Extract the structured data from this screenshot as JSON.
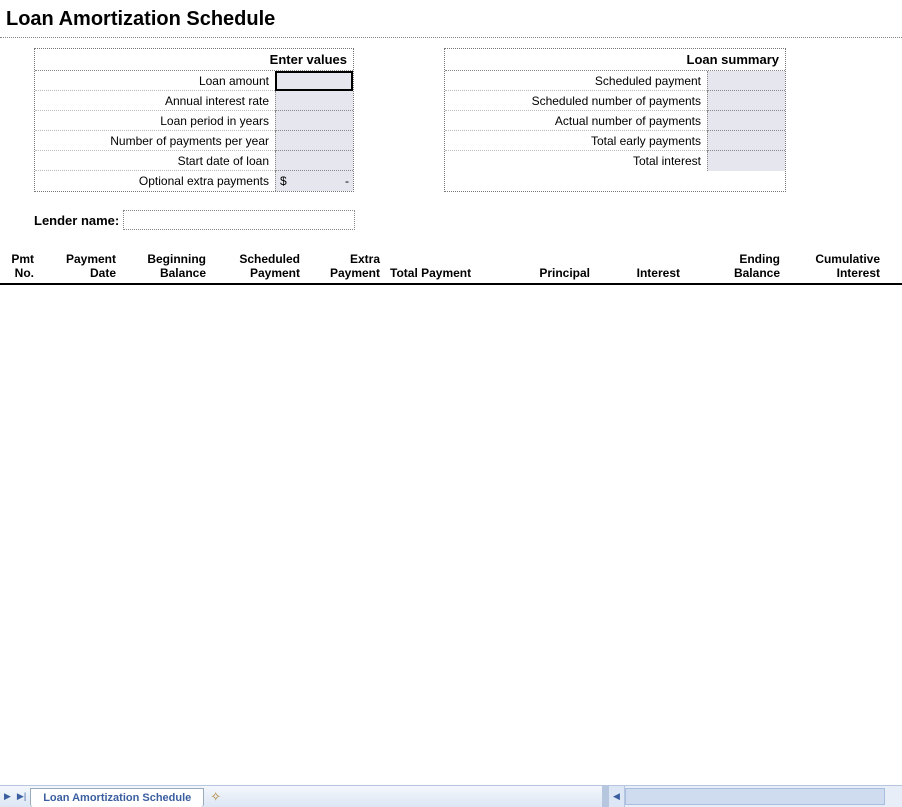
{
  "title": "Loan Amortization Schedule",
  "enter_values": {
    "header": "Enter values",
    "rows": [
      {
        "label": "Loan amount",
        "value": ""
      },
      {
        "label": "Annual interest rate",
        "value": ""
      },
      {
        "label": "Loan period in years",
        "value": ""
      },
      {
        "label": "Number of payments per year",
        "value": ""
      },
      {
        "label": "Start date of loan",
        "value": ""
      },
      {
        "label": "Optional extra payments",
        "value_prefix": "$",
        "value_suffix": "-"
      }
    ]
  },
  "loan_summary": {
    "header": "Loan summary",
    "rows": [
      {
        "label": "Scheduled payment"
      },
      {
        "label": "Scheduled number of payments"
      },
      {
        "label": "Actual number of payments"
      },
      {
        "label": "Total early payments"
      },
      {
        "label": "Total interest"
      }
    ]
  },
  "lender": {
    "label": "Lender name:",
    "value": ""
  },
  "columns": {
    "c1a": "Pmt",
    "c1b": "No.",
    "c2a": "Payment",
    "c2b": "Date",
    "c3a": "Beginning",
    "c3b": "Balance",
    "c4a": "Scheduled",
    "c4b": "Payment",
    "c5a": "Extra",
    "c5b": "Payment",
    "c6": "Total Payment",
    "c7": "Principal",
    "c8": "Interest",
    "c9a": "Ending",
    "c9b": "Balance",
    "c10a": "Cumulative",
    "c10b": "Interest"
  },
  "sheet_tab": "Loan Amortization Schedule"
}
